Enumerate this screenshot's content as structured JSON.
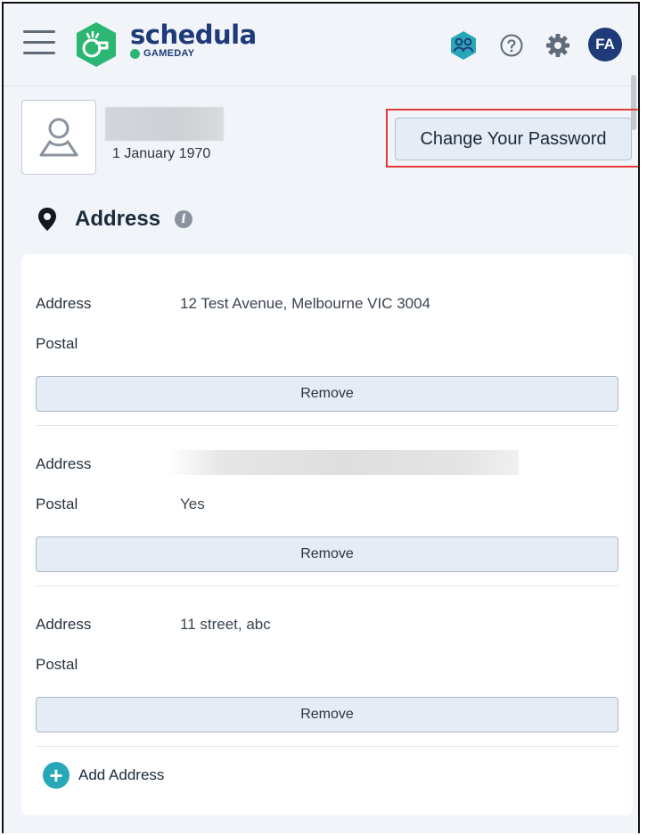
{
  "header": {
    "brand": "schedula",
    "brand_sub": "GAMEDAY",
    "avatar_initials": "FA",
    "icons": [
      "menu-icon",
      "logo-whistle-icon",
      "team-icon",
      "help-icon",
      "settings-icon"
    ]
  },
  "profile": {
    "dob": "1 January 1970",
    "change_password_label": "Change Your Password"
  },
  "address_section": {
    "title": "Address",
    "entries": [
      {
        "address_label": "Address",
        "address_value": "12 Test Avenue, Melbourne VIC 3004",
        "postal_label": "Postal",
        "postal_value": "",
        "remove_label": "Remove"
      },
      {
        "address_label": "Address",
        "address_value": "",
        "postal_label": "Postal",
        "postal_value": "Yes",
        "remove_label": "Remove"
      },
      {
        "address_label": "Address",
        "address_value": "11 street, abc",
        "postal_label": "Postal",
        "postal_value": "",
        "remove_label": "Remove"
      }
    ],
    "add_label": "Add Address"
  },
  "colors": {
    "brand_navy": "#1f3a78",
    "brand_green": "#2bb673",
    "accent_teal": "#28a7b8",
    "highlight_red": "#e53935"
  }
}
